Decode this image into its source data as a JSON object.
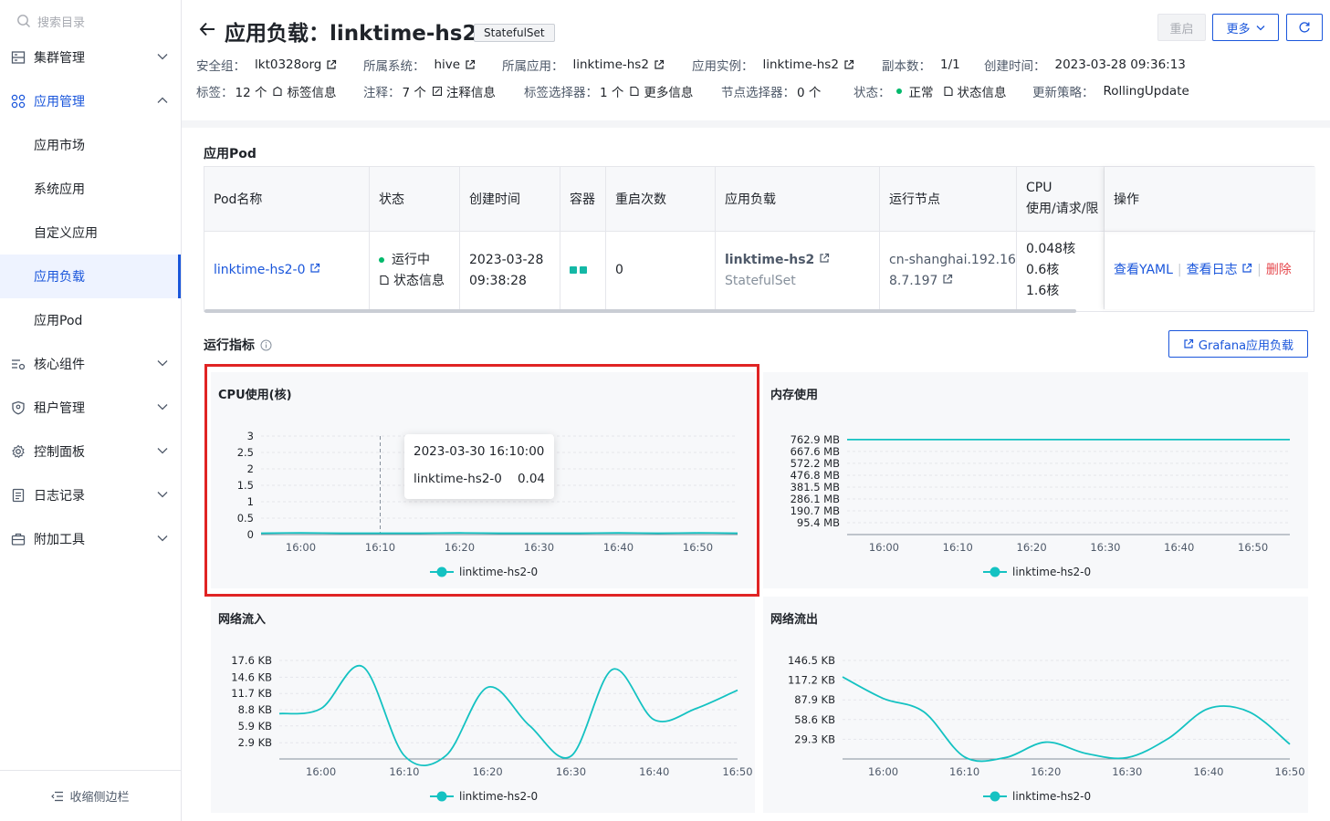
{
  "sidebar": {
    "search_placeholder": "搜索目录",
    "groups": [
      {
        "label": "集群管理",
        "icon": "cluster-icon",
        "expanded": false
      },
      {
        "label": "应用管理",
        "icon": "apps-icon",
        "expanded": true
      },
      {
        "label": "核心组件",
        "icon": "components-icon",
        "expanded": false
      },
      {
        "label": "租户管理",
        "icon": "tenant-icon",
        "expanded": false
      },
      {
        "label": "控制面板",
        "icon": "gear-icon",
        "expanded": false
      },
      {
        "label": "日志记录",
        "icon": "log-icon",
        "expanded": false
      },
      {
        "label": "附加工具",
        "icon": "toolbox-icon",
        "expanded": false
      }
    ],
    "app_sub_items": [
      "应用市场",
      "系统应用",
      "自定义应用",
      "应用负载",
      "应用Pod"
    ],
    "selected_sub": "应用负载",
    "collapse_label": "收缩侧边栏"
  },
  "header": {
    "title": "应用负载：linktime-hs2",
    "kind_tag": "StatefulSet",
    "restart_label": "重启",
    "more_label": "更多",
    "row1": {
      "security_group_k": "安全组：",
      "security_group_v": "lkt0328org",
      "system_k": "所属系统：",
      "system_v": "hive",
      "app_k": "所属应用：",
      "app_v": "linktime-hs2",
      "instance_k": "应用实例：",
      "instance_v": "linktime-hs2",
      "replicas_k": "副本数：",
      "replicas_v": "1/1",
      "created_k": "创建时间：",
      "created_v": "2023-03-28 09:36:13"
    },
    "row2": {
      "labels_k": "标签：",
      "labels_v": "12 个",
      "labels_info": "标签信息",
      "annotations_k": "注释：",
      "annotations_v": "7 个",
      "annotations_info": "注释信息",
      "selector_k": "标签选择器：",
      "selector_v": "1 个",
      "selector_info": "更多信息",
      "node_selector_k": "节点选择器：",
      "node_selector_v": "0 个",
      "status_k": "状态：",
      "status_v": "正常",
      "status_info": "状态信息",
      "strategy_k": "更新策略：",
      "strategy_v": "RollingUpdate"
    }
  },
  "pods": {
    "section_title": "应用Pod",
    "columns": [
      "Pod名称",
      "状态",
      "创建时间",
      "容器",
      "重启次数",
      "应用负载",
      "运行节点",
      "CPU",
      "使用/请求/限",
      "操作"
    ],
    "rows": [
      {
        "name": "linktime-hs2-0",
        "status": "运行中",
        "status_info": "状态信息",
        "created_date": "2023-03-28",
        "created_time": "09:38:28",
        "restarts": "0",
        "workload": "linktime-hs2",
        "workload_kind": "StatefulSet",
        "node_line1": "cn-shanghai.192.16",
        "node_line2": "8.7.197",
        "cpu_use": "0.048核",
        "cpu_req": "0.6核",
        "cpu_lim": "1.6核",
        "op_yaml": "查看YAML",
        "op_log": "查看日志",
        "op_delete": "删除"
      }
    ]
  },
  "metrics": {
    "section_title": "运行指标",
    "grafana_label": "Grafana应用负载",
    "tooltip": {
      "time": "2023-03-30 16:10:00",
      "series": "linktime-hs2-0",
      "value": "0.04"
    }
  },
  "chart_data": [
    {
      "type": "line",
      "title": "CPU使用(核)",
      "x": [
        "15:55",
        "16:00",
        "16:05",
        "16:10",
        "16:15",
        "16:20",
        "16:25",
        "16:30",
        "16:35",
        "16:40",
        "16:45",
        "16:50",
        "16:55"
      ],
      "xticks": [
        "16:00",
        "16:10",
        "16:20",
        "16:30",
        "16:40",
        "16:50"
      ],
      "yticks": [
        "0",
        "0.5",
        "1",
        "1.5",
        "2",
        "2.5",
        "3"
      ],
      "ylim": [
        0,
        3
      ],
      "series": [
        {
          "name": "linktime-hs2-0",
          "values": [
            0.04,
            0.05,
            0.04,
            0.04,
            0.04,
            0.05,
            0.04,
            0.04,
            0.04,
            0.05,
            0.04,
            0.05,
            0.04
          ]
        }
      ]
    },
    {
      "type": "line",
      "title": "内存使用",
      "x": [
        "15:55",
        "16:55"
      ],
      "xticks": [
        "16:00",
        "16:10",
        "16:20",
        "16:30",
        "16:40",
        "16:50"
      ],
      "yticks": [
        "95.4 MB",
        "190.7 MB",
        "286.1 MB",
        "381.5 MB",
        "476.8 MB",
        "572.2 MB",
        "667.6 MB",
        "762.9 MB"
      ],
      "series": [
        {
          "name": "linktime-hs2-0",
          "values": [
            762.9,
            762.9
          ]
        }
      ]
    },
    {
      "type": "line",
      "title": "网络流入",
      "x": [
        "15:55",
        "16:00",
        "16:05",
        "16:10",
        "16:15",
        "16:20",
        "16:25",
        "16:30",
        "16:35",
        "16:40",
        "16:45",
        "16:50"
      ],
      "xticks": [
        "16:00",
        "16:10",
        "16:20",
        "16:30",
        "16:40",
        "16:50"
      ],
      "yticks": [
        "2.9 KB",
        "5.9 KB",
        "8.8 KB",
        "11.7 KB",
        "14.6 KB",
        "17.6 KB"
      ],
      "ylim": [
        0,
        17.6
      ],
      "series": [
        {
          "name": "linktime-hs2-0",
          "values": [
            8.1,
            9.0,
            16.5,
            0.6,
            0.6,
            12.8,
            6.0,
            0.5,
            16.0,
            7.0,
            9.0,
            12.3
          ]
        }
      ]
    },
    {
      "type": "line",
      "title": "网络流出",
      "x": [
        "15:55",
        "16:00",
        "16:05",
        "16:10",
        "16:15",
        "16:20",
        "16:25",
        "16:30",
        "16:35",
        "16:40",
        "16:45",
        "16:50"
      ],
      "xticks": [
        "16:00",
        "16:10",
        "16:20",
        "16:30",
        "16:40",
        "16:50"
      ],
      "yticks": [
        "29.3 KB",
        "58.6 KB",
        "87.9 KB",
        "117.2 KB",
        "146.5 KB"
      ],
      "ylim": [
        0,
        146.5
      ],
      "series": [
        {
          "name": "linktime-hs2-0",
          "values": [
            122,
            90,
            70,
            3,
            2,
            25,
            8,
            2,
            30,
            75,
            70,
            22
          ]
        }
      ]
    }
  ],
  "colors": {
    "accent": "#1a56db",
    "series": "#14c2c2",
    "highlight": "#e02424",
    "ok": "#00b96b"
  }
}
